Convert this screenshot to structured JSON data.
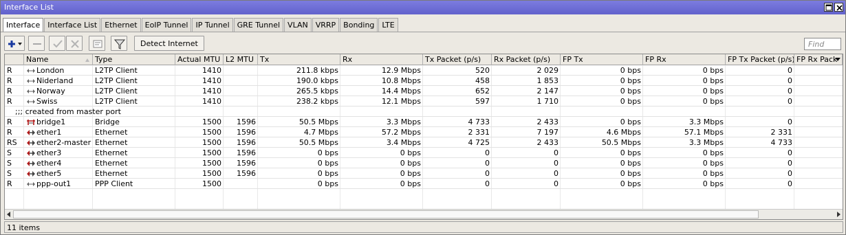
{
  "window": {
    "title": "Interface List"
  },
  "tabs": [
    "Interface",
    "Interface List",
    "Ethernet",
    "EoIP Tunnel",
    "IP Tunnel",
    "GRE Tunnel",
    "VLAN",
    "VRRP",
    "Bonding",
    "LTE"
  ],
  "toolbar": {
    "detect_label": "Detect Internet",
    "find_placeholder": "Find"
  },
  "columns": [
    "",
    "Name",
    "Type",
    "Actual MTU",
    "L2 MTU",
    "Tx",
    "Rx",
    "Tx Packet (p/s)",
    "Rx Packet (p/s)",
    "FP Tx",
    "FP Rx",
    "FP Tx Packet (p/s)",
    "FP Rx Pack"
  ],
  "comment": ";;; created from master port",
  "rows": [
    {
      "flags": "R",
      "icon": "l2tp-icon",
      "name": "London",
      "type": "L2TP Client",
      "mtu": "1410",
      "l2mtu": "",
      "tx": "211.8 kbps",
      "rx": "12.9 Mbps",
      "txp": "520",
      "rxp": "2 029",
      "fptx": "0 bps",
      "fprx": "0 bps",
      "fptxp": "0"
    },
    {
      "flags": "R",
      "icon": "l2tp-icon",
      "name": "Niderland",
      "type": "L2TP Client",
      "mtu": "1410",
      "l2mtu": "",
      "tx": "190.0 kbps",
      "rx": "10.8 Mbps",
      "txp": "458",
      "rxp": "1 853",
      "fptx": "0 bps",
      "fprx": "0 bps",
      "fptxp": "0"
    },
    {
      "flags": "R",
      "icon": "l2tp-icon",
      "name": "Norway",
      "type": "L2TP Client",
      "mtu": "1410",
      "l2mtu": "",
      "tx": "265.5 kbps",
      "rx": "14.4 Mbps",
      "txp": "652",
      "rxp": "2 147",
      "fptx": "0 bps",
      "fprx": "0 bps",
      "fptxp": "0"
    },
    {
      "flags": "R",
      "icon": "l2tp-icon",
      "name": "Swiss",
      "type": "L2TP Client",
      "mtu": "1410",
      "l2mtu": "",
      "tx": "238.2 kbps",
      "rx": "12.1 Mbps",
      "txp": "597",
      "rxp": "1 710",
      "fptx": "0 bps",
      "fprx": "0 bps",
      "fptxp": "0"
    },
    {
      "flags": "R",
      "icon": "bridge-icon",
      "name": "bridge1",
      "type": "Bridge",
      "mtu": "1500",
      "l2mtu": "1596",
      "tx": "50.5 Mbps",
      "rx": "3.3 Mbps",
      "txp": "4 733",
      "rxp": "2 433",
      "fptx": "0 bps",
      "fprx": "3.3 Mbps",
      "fptxp": "0"
    },
    {
      "flags": "R",
      "icon": "ethernet-icon",
      "name": "ether1",
      "type": "Ethernet",
      "mtu": "1500",
      "l2mtu": "1596",
      "tx": "4.7 Mbps",
      "rx": "57.2 Mbps",
      "txp": "2 331",
      "rxp": "7 197",
      "fptx": "4.6 Mbps",
      "fprx": "57.1 Mbps",
      "fptxp": "2 331"
    },
    {
      "flags": "RS",
      "icon": "ethernet-icon",
      "name": "ether2-master",
      "type": "Ethernet",
      "mtu": "1500",
      "l2mtu": "1596",
      "tx": "50.5 Mbps",
      "rx": "3.4 Mbps",
      "txp": "4 725",
      "rxp": "2 433",
      "fptx": "50.5 Mbps",
      "fprx": "3.3 Mbps",
      "fptxp": "4 733"
    },
    {
      "flags": "S",
      "icon": "ethernet-icon",
      "name": "ether3",
      "type": "Ethernet",
      "mtu": "1500",
      "l2mtu": "1596",
      "tx": "0 bps",
      "rx": "0 bps",
      "txp": "0",
      "rxp": "0",
      "fptx": "0 bps",
      "fprx": "0 bps",
      "fptxp": "0"
    },
    {
      "flags": "S",
      "icon": "ethernet-icon",
      "name": "ether4",
      "type": "Ethernet",
      "mtu": "1500",
      "l2mtu": "1596",
      "tx": "0 bps",
      "rx": "0 bps",
      "txp": "0",
      "rxp": "0",
      "fptx": "0 bps",
      "fprx": "0 bps",
      "fptxp": "0"
    },
    {
      "flags": "S",
      "icon": "ethernet-icon",
      "name": "ether5",
      "type": "Ethernet",
      "mtu": "1500",
      "l2mtu": "1596",
      "tx": "0 bps",
      "rx": "0 bps",
      "txp": "0",
      "rxp": "0",
      "fptx": "0 bps",
      "fprx": "0 bps",
      "fptxp": "0"
    },
    {
      "flags": "R",
      "icon": "ppp-icon",
      "name": "ppp-out1",
      "type": "PPP Client",
      "mtu": "1500",
      "l2mtu": "",
      "tx": "0 bps",
      "rx": "0 bps",
      "txp": "0",
      "rxp": "0",
      "fptx": "0 bps",
      "fprx": "0 bps",
      "fptxp": "0"
    }
  ],
  "status": {
    "items_text": "11 items"
  },
  "colors": {
    "titlebar": "#6a6ad6",
    "add_icon": "#1a3aa0",
    "ether_icon": "#b01a1a"
  }
}
